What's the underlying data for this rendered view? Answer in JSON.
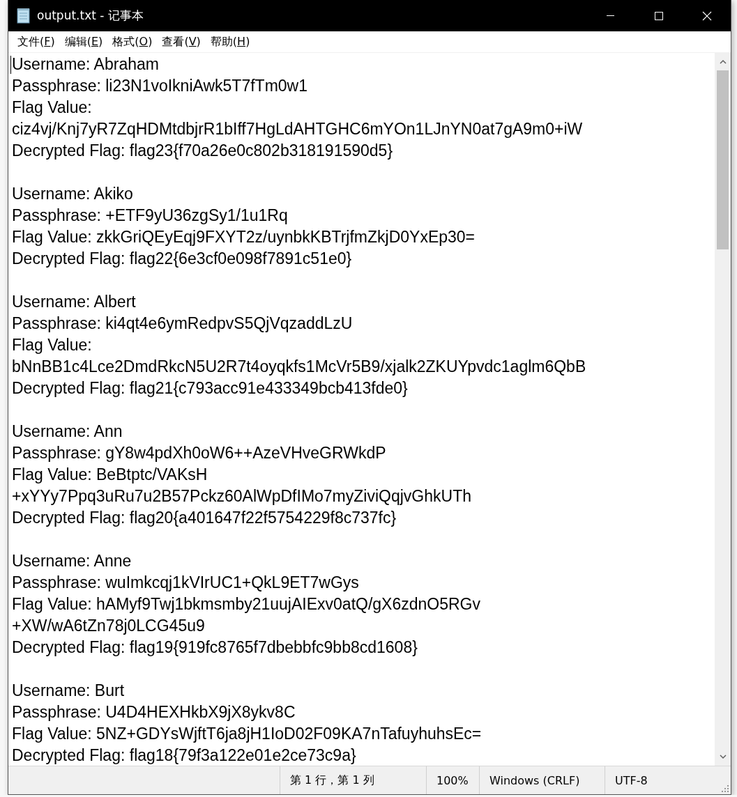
{
  "window": {
    "title": "output.txt - 记事本"
  },
  "menu": [
    {
      "label": "文件(F)"
    },
    {
      "label": "编辑(E)"
    },
    {
      "label": "格式(O)"
    },
    {
      "label": "查看(V)"
    },
    {
      "label": "帮助(H)"
    }
  ],
  "records": [
    {
      "lines": [
        "Username: Abraham",
        "Passphrase: li23N1voIkniAwk5T7fTm0w1",
        "Flag Value:",
        "ciz4vj/Knj7yR7ZqHDMtdbjrR1bIff7HgLdAHTGHC6mYOn1LJnYN0at7gA9m0+iW",
        "Decrypted Flag: flag23{f70a26e0c802b318191590d5}"
      ]
    },
    {
      "lines": [
        "Username: Akiko",
        "Passphrase: +ETF9yU36zgSy1/1u1Rq",
        "Flag Value: zkkGriQEyEqj9FXYT2z/uynbkKBTrjfmZkjD0YxEp30=",
        "Decrypted Flag: flag22{6e3cf0e098f7891c51e0}"
      ]
    },
    {
      "lines": [
        "Username: Albert",
        "Passphrase: ki4qt4e6ymRedpvS5QjVqzaddLzU",
        "Flag Value:",
        "bNnBB1c4Lce2DmdRkcN5U2R7t4oyqkfs1McVr5B9/xjalk2ZKUYpvdc1aglm6QbB",
        "Decrypted Flag: flag21{c793acc91e433349bcb413fde0}"
      ]
    },
    {
      "lines": [
        "Username: Ann",
        "Passphrase: gY8w4pdXh0oW6++AzeVHveGRWkdP",
        "Flag Value: BeBtptc/VAKsH",
        "+xYYy7Ppq3uRu7u2B57Pckz60AlWpDfIMo7myZiviQqjvGhkUTh",
        "Decrypted Flag: flag20{a401647f22f5754229f8c737fc}"
      ]
    },
    {
      "lines": [
        "Username: Anne",
        "Passphrase: wuImkcqj1kVIrUC1+QkL9ET7wGys",
        "Flag Value: hAMyf9Twj1bkmsmby21uujAIExv0atQ/gX6zdnO5RGv",
        "+XW/wA6tZn78j0LCG45u9",
        "Decrypted Flag: flag19{919fc8765f7dbebbfc9bb8cd1608}"
      ]
    },
    {
      "lines": [
        "Username: Burt",
        "Passphrase: U4D4HEXHkbX9jX8ykv8C",
        "Flag Value: 5NZ+GDYsWjftT6ja8jH1IoD02F09KA7nTafuyhuhsEc=",
        "Decrypted Flag: flag18{79f3a122e01e2ce73c9a}"
      ]
    }
  ],
  "status_bar": {
    "position": "第 1 行，第 1 列",
    "zoom": "100%",
    "line_ending": "Windows (CRLF)",
    "encoding": "UTF-8"
  }
}
